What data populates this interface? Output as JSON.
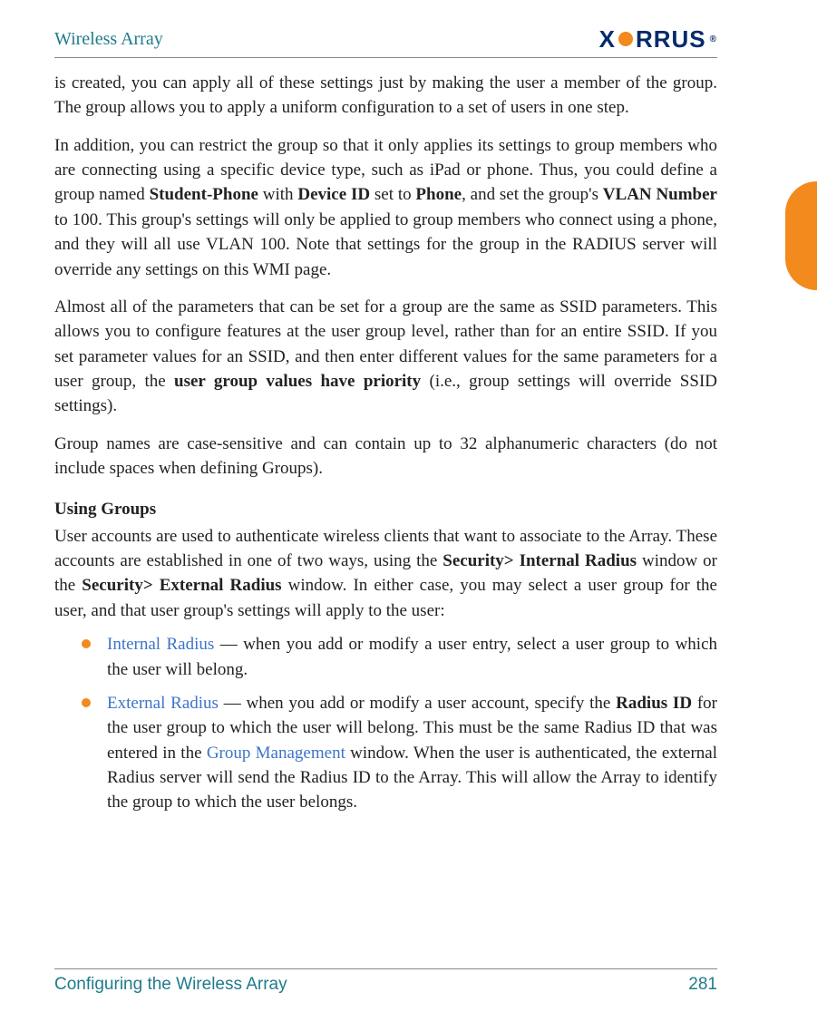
{
  "header": {
    "title": "Wireless Array",
    "brand_parts": {
      "x": "X",
      "rrus": "RRUS",
      "reg": "®"
    }
  },
  "body": {
    "p1_a": "is created, you can apply all of these settings just by making the user a member of the group. The group allows you to apply a uniform configuration to a set of users in one step.",
    "p2_a": "In addition, you can restrict the group so that it only applies its settings to group members who are connecting using a specific device type, such as iPad or phone. Thus, you could define a group named ",
    "p2_b_student_phone": "Student-Phone",
    "p2_c": " with ",
    "p2_b_device_id": "Device ID",
    "p2_d": " set to ",
    "p2_b_phone": "Phone",
    "p2_e": ", and set the group's ",
    "p2_b_vlan": "VLAN Number",
    "p2_f": " to 100. This group's settings will only be applied to group members who connect using a phone, and they will all use VLAN 100. Note that settings for the group in the RADIUS server will override any settings on this WMI page.",
    "p3_a": "Almost all of the parameters that can be set for a group are the same as SSID parameters. This allows you to configure features at the user group level, rather than for an entire SSID. If you set parameter values for an SSID, and then enter different values for the same parameters for a user group, the ",
    "p3_b_priority": "user group values have priority",
    "p3_c": " (i.e., group settings will override SSID settings).",
    "p4_a": "Group names are case-sensitive and can contain up to 32 alphanumeric characters (do not include spaces when defining Groups).",
    "h_using_groups": "Using Groups",
    "p5_a": "User accounts are used to authenticate wireless clients that want to associate to the Array. These accounts are established in one of two ways, using the ",
    "p5_b_sec_int": "Security> Internal Radius",
    "p5_c": " window or the ",
    "p5_b_sec_ext": "Security> External Radius",
    "p5_d": " window. In either case, you may select a user group for the user, and that user group's settings will apply to the user:",
    "bul1_link": "Internal Radius",
    "bul1_rest": " — when you add or modify a user entry, select a user group to which the user will belong.",
    "bul2_link": "External Radius",
    "bul2_a": " — when you add or modify a user account, specify the ",
    "bul2_b_radius_id": "Radius ID",
    "bul2_c": " for the user group to which the user will belong. This must be the same Radius ID that was entered in the ",
    "bul2_link2": "Group Management",
    "bul2_d": " window. When the user is authenticated, the external Radius server will send the Radius ID to the Array. This will allow the Array to identify the group to which the user belongs."
  },
  "footer": {
    "text": "Configuring the Wireless Array",
    "page": "281"
  }
}
